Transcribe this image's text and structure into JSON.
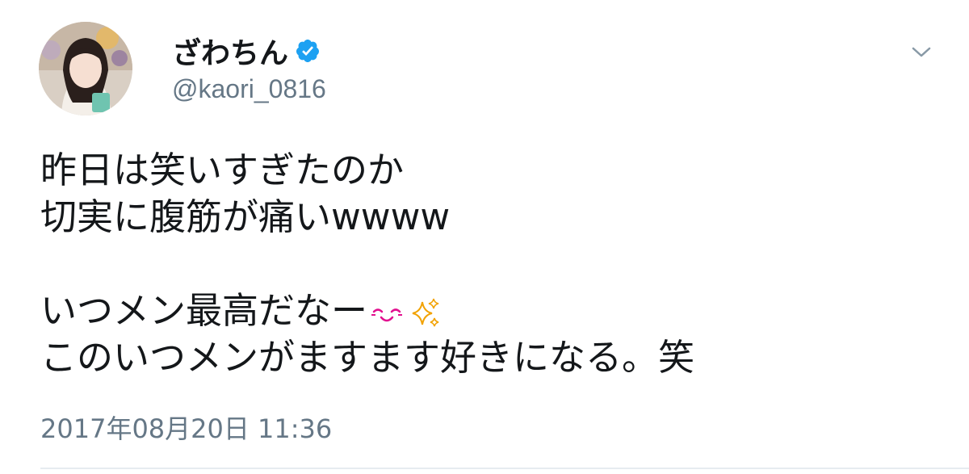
{
  "tweet": {
    "display_name": "ざわちん",
    "handle": "@kaori_0816",
    "verified": true,
    "lines": [
      "昨日は笑いすぎたのか",
      "切実に腹筋が痛いwwww",
      "",
      "いつメン最高だなー",
      "このいつメンがますます好きになる。笑"
    ],
    "emojis_line4": [
      "blushing-face-emoji",
      "sparkles-emoji"
    ],
    "timestamp": "2017年08月20日 11:36"
  },
  "colors": {
    "text": "#14171a",
    "secondary": "#657786",
    "verified_blue": "#1da1f2",
    "divider": "#e6ecf0",
    "emoji_pink": "#e2108f",
    "emoji_orange": "#f2a200"
  }
}
